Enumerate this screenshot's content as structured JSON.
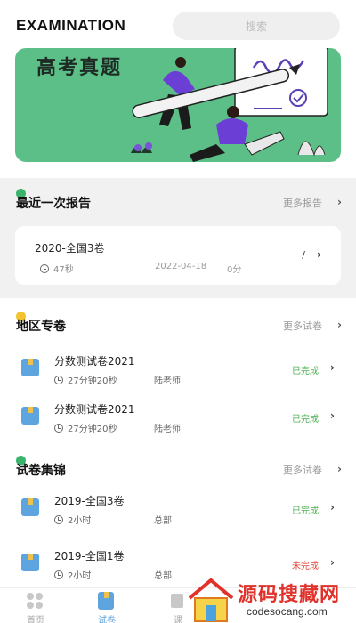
{
  "header": {
    "title": "EXAMINATION",
    "search_placeholder": "搜索"
  },
  "banner": {
    "title": "高考真题"
  },
  "sections": {
    "recent": {
      "title": "最近一次报告",
      "more": "更多报告",
      "dot_color": "#3ab36b"
    },
    "region": {
      "title": "地区专卷",
      "more": "更多试卷",
      "dot_color": "#f2c530"
    },
    "collection": {
      "title": "试卷集锦",
      "more": "更多试卷",
      "dot_color": "#3ab36b"
    }
  },
  "report": {
    "name": "2020-全国3卷",
    "duration": "47秒",
    "date": "2022-04-18",
    "score": "0分",
    "slash": "/"
  },
  "region_papers": [
    {
      "name": "分数测试卷2021",
      "time": "27分钟20秒",
      "teacher": "陆老师",
      "status": "已完成",
      "status_color": "#4caf50"
    },
    {
      "name": "分数测试卷2021",
      "time": "27分钟20秒",
      "teacher": "陆老师",
      "status": "已完成",
      "status_color": "#4caf50"
    }
  ],
  "collection_papers": [
    {
      "name": "2019-全国3卷",
      "time": "2小时",
      "teacher": "总部",
      "status": "已完成",
      "status_color": "#4caf50"
    },
    {
      "name": "2019-全国1卷",
      "time": "2小时",
      "teacher": "总部",
      "status": "未完成",
      "status_color": "#e04a3a"
    }
  ],
  "tabs": [
    {
      "label": "首页",
      "icon": "home-grid-icon"
    },
    {
      "label": "试卷",
      "icon": "paper-icon"
    },
    {
      "label": "课",
      "icon": "course-icon"
    }
  ],
  "watermark": {
    "text": "源码搜藏网",
    "url": "codesocang.com"
  },
  "icons": {
    "arrow": "›"
  }
}
